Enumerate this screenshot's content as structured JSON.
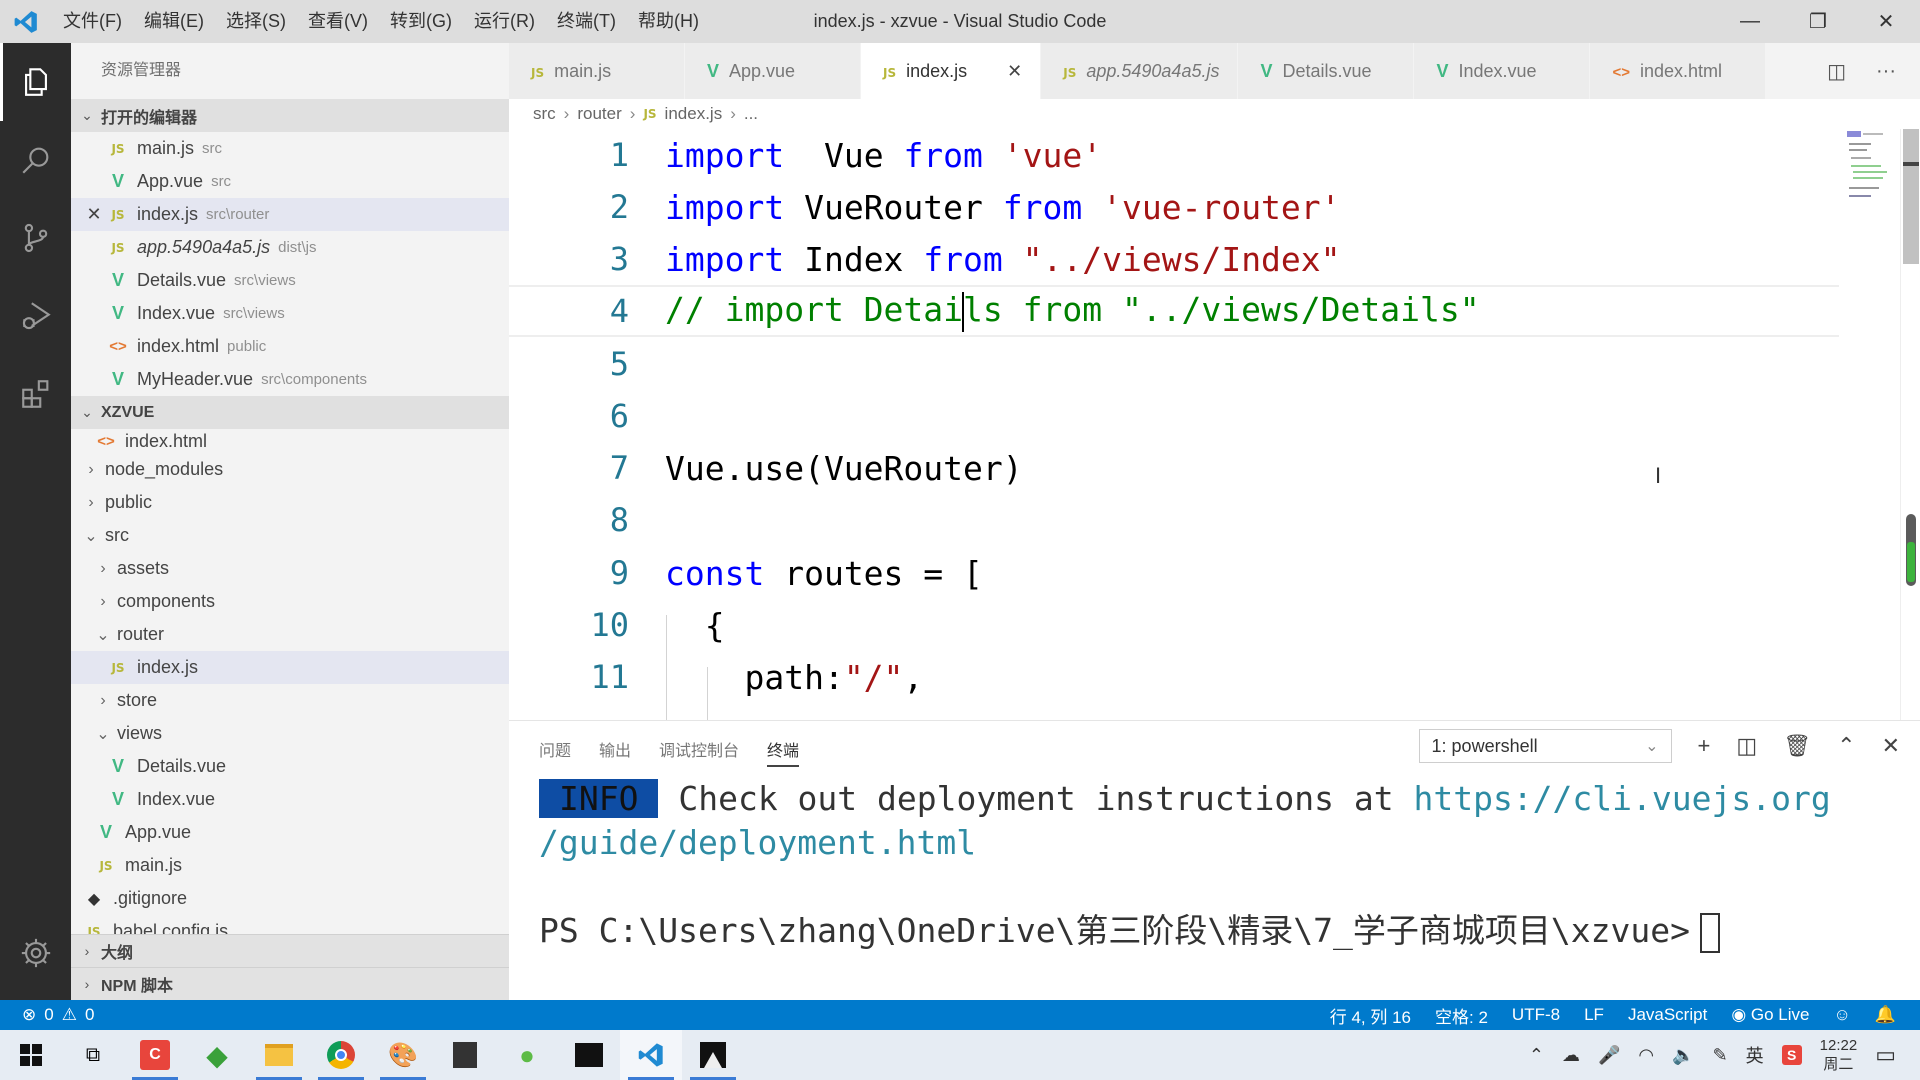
{
  "window": {
    "title": "index.js - xzvue - Visual Studio Code",
    "menu": [
      "文件(F)",
      "编辑(E)",
      "选择(S)",
      "查看(V)",
      "转到(G)",
      "运行(R)",
      "终端(T)",
      "帮助(H)"
    ],
    "controls": {
      "minimize": "—",
      "restore": "❐",
      "close": "✕"
    }
  },
  "activity_bar": {
    "items": [
      {
        "name": "explorer",
        "icon": "files-icon",
        "active": true
      },
      {
        "name": "search",
        "icon": "search-icon"
      },
      {
        "name": "source-control",
        "icon": "source-control-icon"
      },
      {
        "name": "run-debug",
        "icon": "run-debug-icon"
      },
      {
        "name": "extensions",
        "icon": "extensions-icon"
      }
    ],
    "settings_icon": "gear-icon"
  },
  "sidebar": {
    "title": "资源管理器",
    "open_editors": {
      "label": "打开的编辑器",
      "items": [
        {
          "name": "main.js",
          "desc": "src",
          "type": "js"
        },
        {
          "name": "App.vue",
          "desc": "src",
          "type": "vue"
        },
        {
          "name": "index.js",
          "desc": "src\\router",
          "type": "js",
          "selected": true,
          "close": "✕"
        },
        {
          "name": "app.5490a4a5.js",
          "desc": "dist\\js",
          "type": "js",
          "italic": true
        },
        {
          "name": "Details.vue",
          "desc": "src\\views",
          "type": "vue"
        },
        {
          "name": "Index.vue",
          "desc": "src\\views",
          "type": "vue"
        },
        {
          "name": "index.html",
          "desc": "public",
          "type": "html"
        },
        {
          "name": "MyHeader.vue",
          "desc": "src\\components",
          "type": "vue"
        }
      ]
    },
    "project": {
      "label": "XZVUE",
      "tree": [
        {
          "name": "index.html",
          "type": "html",
          "depth": 1
        },
        {
          "name": "node_modules",
          "type": "folder",
          "state": "collapsed",
          "depth": 0
        },
        {
          "name": "public",
          "type": "folder",
          "state": "collapsed",
          "depth": 0
        },
        {
          "name": "src",
          "type": "folder",
          "state": "expanded",
          "depth": 0
        },
        {
          "name": "assets",
          "type": "folder",
          "state": "collapsed",
          "depth": 1
        },
        {
          "name": "components",
          "type": "folder",
          "state": "collapsed",
          "depth": 1
        },
        {
          "name": "router",
          "type": "folder",
          "state": "expanded",
          "depth": 1
        },
        {
          "name": "index.js",
          "type": "js",
          "depth": 2,
          "selected": true
        },
        {
          "name": "store",
          "type": "folder",
          "state": "collapsed",
          "depth": 1
        },
        {
          "name": "views",
          "type": "folder",
          "state": "expanded",
          "depth": 1
        },
        {
          "name": "Details.vue",
          "type": "vue",
          "depth": 2
        },
        {
          "name": "Index.vue",
          "type": "vue",
          "depth": 2
        },
        {
          "name": "App.vue",
          "type": "vue",
          "depth": 1
        },
        {
          "name": "main.js",
          "type": "js",
          "depth": 1
        },
        {
          "name": ".gitignore",
          "type": "git",
          "depth": 0
        },
        {
          "name": "babel.config.js",
          "type": "js",
          "depth": 0
        }
      ]
    },
    "outline_label": "大纲",
    "npm_label": "NPM 脚本"
  },
  "tabs": [
    {
      "label": "main.js",
      "type": "js"
    },
    {
      "label": "App.vue",
      "type": "vue"
    },
    {
      "label": "index.js",
      "type": "js",
      "active": true,
      "close": "✕"
    },
    {
      "label": "app.5490a4a5.js",
      "type": "js",
      "italic": true
    },
    {
      "label": "Details.vue",
      "type": "vue"
    },
    {
      "label": "Index.vue",
      "type": "vue"
    },
    {
      "label": "index.html",
      "type": "html"
    }
  ],
  "breadcrumb": [
    "src",
    "router",
    "index.js",
    "..."
  ],
  "editor": {
    "lines": [
      {
        "n": "1",
        "tokens": [
          [
            "kw",
            "import"
          ],
          [
            "",
            "  Vue "
          ],
          [
            "kw",
            "from"
          ],
          [
            "str",
            " 'vue'"
          ]
        ]
      },
      {
        "n": "2",
        "tokens": [
          [
            "kw",
            "import"
          ],
          [
            "",
            " VueRouter "
          ],
          [
            "kw",
            "from"
          ],
          [
            "str",
            " 'vue-router'"
          ]
        ]
      },
      {
        "n": "3",
        "tokens": [
          [
            "kw",
            "import"
          ],
          [
            "",
            " Index "
          ],
          [
            "kw",
            "from"
          ],
          [
            "str",
            " \"../views/Index\""
          ]
        ]
      },
      {
        "n": "4",
        "tokens": [
          [
            "cm",
            "// import Detai"
          ],
          [
            "caret",
            ""
          ],
          [
            "cm",
            "ls from \"../views/Details\""
          ]
        ],
        "current": true
      },
      {
        "n": "5",
        "tokens": []
      },
      {
        "n": "6",
        "tokens": []
      },
      {
        "n": "7",
        "tokens": [
          [
            "",
            "Vue.use(VueRouter)"
          ]
        ]
      },
      {
        "n": "8",
        "tokens": []
      },
      {
        "n": "9",
        "tokens": [
          [
            "kw",
            "const"
          ],
          [
            "",
            " routes = ["
          ]
        ]
      },
      {
        "n": "10",
        "tokens": [
          [
            "",
            "  {"
          ]
        ]
      },
      {
        "n": "11",
        "tokens": [
          [
            "",
            "    path:"
          ],
          [
            "str",
            "\"/\""
          ],
          [
            "",
            ","
          ]
        ]
      }
    ]
  },
  "panel": {
    "tabs": [
      "问题",
      "输出",
      "调试控制台",
      "终端"
    ],
    "active_tab": "终端",
    "terminal_select": "1: powershell",
    "terminal": {
      "info_badge": "INFO",
      "info_text": " Check out deployment instructions at ",
      "link_part1": "https://cli.vuejs.org",
      "link_part2": "/guide/deployment.html",
      "prompt": "PS C:\\Users\\zhang\\OneDrive\\第三阶段\\精录\\7_学子商城项目\\xzvue>"
    }
  },
  "statusbar": {
    "errors": "0",
    "warnings": "0",
    "position": "行 4, 列 16",
    "spaces": "空格: 2",
    "encoding": "UTF-8",
    "eol": "LF",
    "language": "JavaScript",
    "go_live": "Go Live"
  },
  "taskbar": {
    "apps": [
      "start",
      "task-view",
      "camtasia",
      "app-green",
      "file-explorer",
      "chrome",
      "paint",
      "sticky",
      "wechat",
      "terminal",
      "vscode",
      "photos"
    ],
    "time": "12:22",
    "day": "周二",
    "ime": "英"
  }
}
